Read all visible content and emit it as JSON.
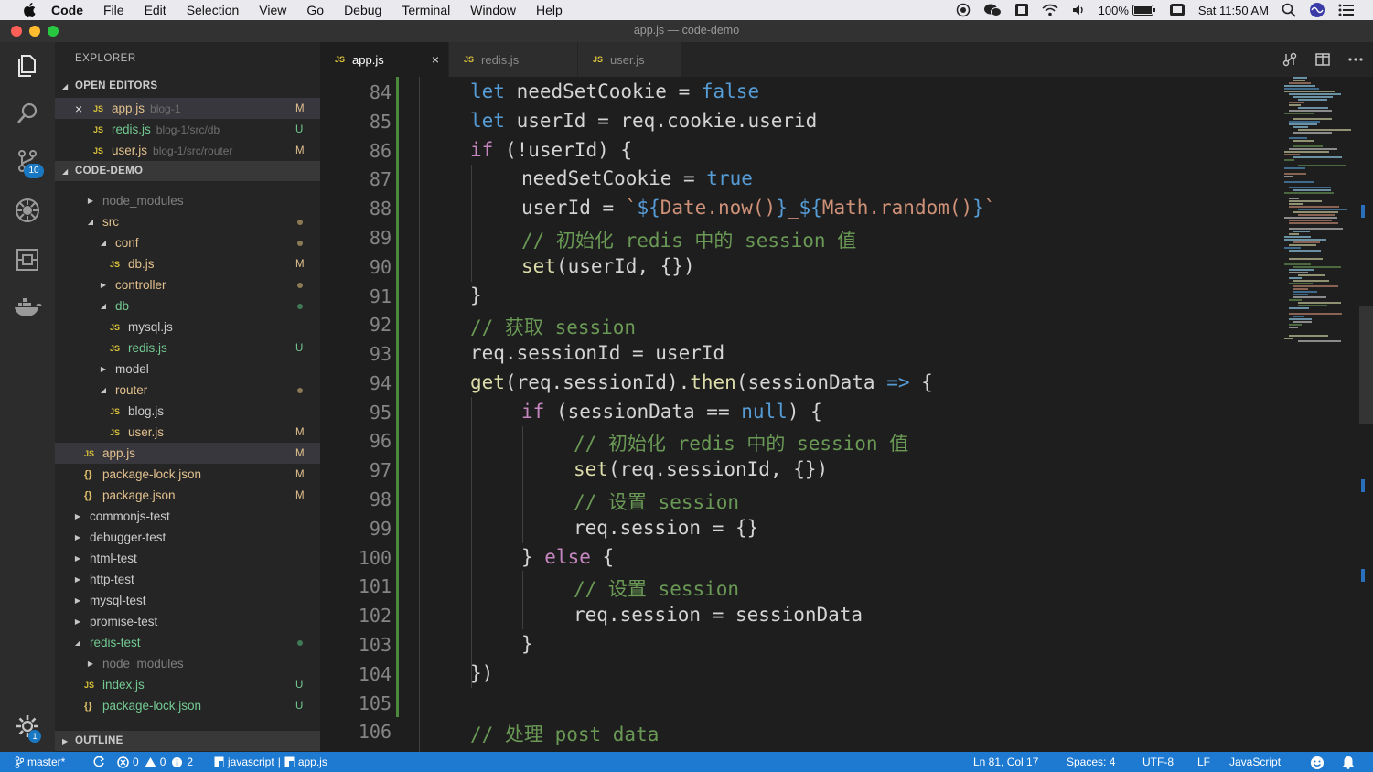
{
  "menubar": {
    "app_name": "Code",
    "items": [
      "File",
      "Edit",
      "Selection",
      "View",
      "Go",
      "Debug",
      "Terminal",
      "Window",
      "Help"
    ],
    "battery": "100%",
    "clock": "Sat 11:50 AM"
  },
  "window": {
    "title": "app.js — code-demo"
  },
  "activity": {
    "scm_badge": "10",
    "settings_badge": "1"
  },
  "sidebar": {
    "title": "EXPLORER",
    "open_editors": {
      "label": "OPEN EDITORS",
      "items": [
        {
          "name": "app.js",
          "hint": "blog-1",
          "status": "M"
        },
        {
          "name": "redis.js",
          "hint": "blog-1/src/db",
          "status": "U"
        },
        {
          "name": "user.js",
          "hint": "blog-1/src/router",
          "status": "M"
        }
      ]
    },
    "project": {
      "label": "CODE-DEMO",
      "items": [
        {
          "name": "node_modules",
          "status": ""
        },
        {
          "name": "src",
          "status": "dot"
        },
        {
          "name": "conf",
          "status": "dot"
        },
        {
          "name": "db.js",
          "status": "M"
        },
        {
          "name": "controller",
          "status": "dot"
        },
        {
          "name": "db",
          "status": "dot"
        },
        {
          "name": "mysql.js",
          "status": ""
        },
        {
          "name": "redis.js",
          "status": "U"
        },
        {
          "name": "model",
          "status": ""
        },
        {
          "name": "router",
          "status": "dot"
        },
        {
          "name": "blog.js",
          "status": ""
        },
        {
          "name": "user.js",
          "status": "M"
        },
        {
          "name": "app.js",
          "status": "M"
        },
        {
          "name": "package-lock.json",
          "status": "M"
        },
        {
          "name": "package.json",
          "status": "M"
        },
        {
          "name": "commonjs-test",
          "status": ""
        },
        {
          "name": "debugger-test",
          "status": ""
        },
        {
          "name": "html-test",
          "status": ""
        },
        {
          "name": "http-test",
          "status": ""
        },
        {
          "name": "mysql-test",
          "status": ""
        },
        {
          "name": "promise-test",
          "status": ""
        },
        {
          "name": "redis-test",
          "status": "dot"
        },
        {
          "name": "node_modules",
          "status": ""
        },
        {
          "name": "index.js",
          "status": "U"
        },
        {
          "name": "package-lock.json",
          "status": "U"
        }
      ]
    },
    "outline": {
      "label": "OUTLINE"
    }
  },
  "tabs": [
    {
      "label": "app.js",
      "active": true
    },
    {
      "label": "redis.js",
      "active": false
    },
    {
      "label": "user.js",
      "active": false
    }
  ],
  "editor": {
    "line_numbers": [
      "84",
      "85",
      "86",
      "87",
      "88",
      "89",
      "90",
      "91",
      "92",
      "93",
      "94",
      "95",
      "96",
      "97",
      "98",
      "99",
      "100",
      "101",
      "102",
      "103",
      "104",
      "105",
      "106"
    ],
    "lines": [
      "let needSetCookie = false",
      "let userId = req.cookie.userid",
      "if (!userId) {",
      "needSetCookie = true",
      "userId = `${Date.now()}_${Math.random()}`",
      "// 初始化 redis 中的 session 值",
      "set(userId, {})",
      "}",
      "// 获取 session",
      "req.sessionId = userId",
      "get(req.sessionId).then(sessionData => {",
      "if (sessionData == null) {",
      "// 初始化 redis 中的 session 值",
      "set(req.sessionId, {})",
      "// 设置 session",
      "req.session = {}",
      "} else {",
      "// 设置 session",
      "req.session = sessionData",
      "}",
      "})",
      "",
      "// 处理 post data"
    ]
  },
  "statusbar": {
    "branch": "master*",
    "errors": "0",
    "warnings": "0",
    "info": "2",
    "lang_path": "javascript",
    "file_path": "app.js",
    "position": "Ln 81, Col 17",
    "spaces": "Spaces: 4",
    "encoding": "UTF-8",
    "eol": "LF",
    "language": "JavaScript"
  },
  "colors": {
    "statusbar_bg": "#1e7ad1",
    "modified": "#e2c08d",
    "untracked": "#73c991",
    "keyword": "#569cd6",
    "comment": "#6a9955"
  }
}
